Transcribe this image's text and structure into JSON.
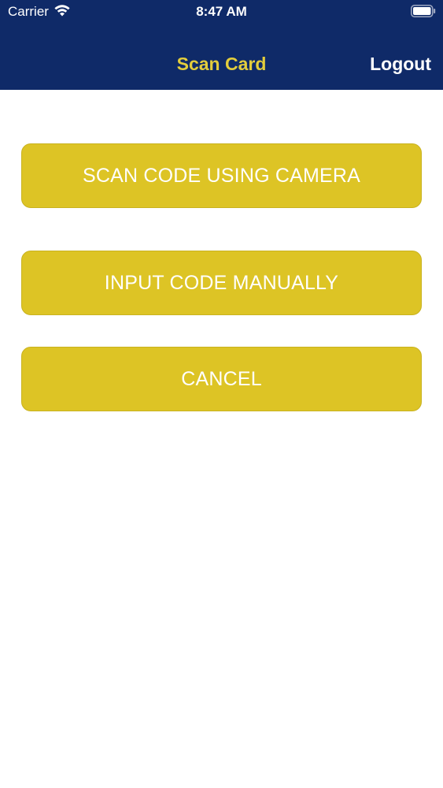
{
  "status_bar": {
    "carrier": "Carrier",
    "time": "8:47 AM",
    "wifi_icon": "wifi-icon",
    "battery_icon": "battery-icon"
  },
  "header": {
    "title": "Scan Card",
    "logout_label": "Logout",
    "background_color": "#0f2a68",
    "title_color": "#e3cd3c"
  },
  "actions": {
    "scan_camera_label": "SCAN CODE USING CAMERA",
    "input_manual_label": "INPUT CODE MANUALLY",
    "cancel_label": "CANCEL",
    "button_color": "#ddc425"
  }
}
